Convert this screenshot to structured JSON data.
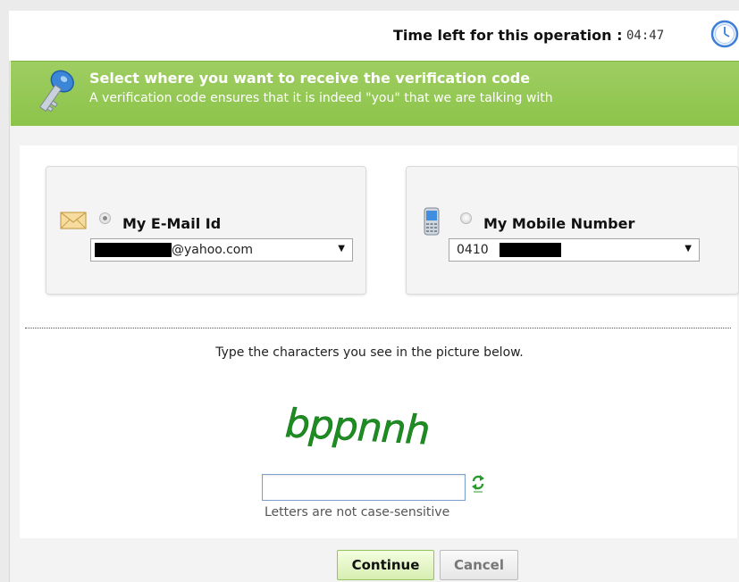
{
  "timer": {
    "label": "Time left for this operation :",
    "value": "04:47"
  },
  "banner": {
    "title": "Select where you want to receive the verification code",
    "subtitle": "A verification code ensures that it is indeed \"you\" that we are talking with"
  },
  "options": {
    "email": {
      "label": "My E-Mail Id",
      "selected": true,
      "value": "@yahoo.com"
    },
    "mobile": {
      "label": "My Mobile Number",
      "selected": false,
      "value": "0410"
    }
  },
  "captcha": {
    "instruction": "Type the characters you see in the picture below.",
    "image_text": "bppnnh",
    "input_value": "",
    "note": "Letters are not case-sensitive"
  },
  "buttons": {
    "continue": "Continue",
    "cancel": "Cancel"
  },
  "colors": {
    "banner_green": "#8cc44a",
    "captcha_green": "#1e8c23"
  },
  "icons": [
    "clock-icon",
    "key-icon",
    "envelope-icon",
    "mobile-phone-icon",
    "refresh-icon",
    "dropdown-caret-icon"
  ]
}
